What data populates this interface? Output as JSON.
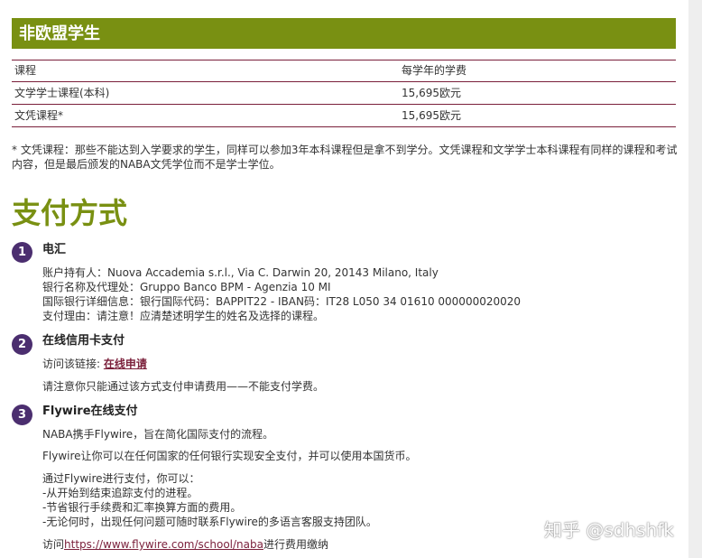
{
  "header": {
    "title": "非欧盟学生"
  },
  "fee_table": {
    "columns": [
      "课程",
      "每学年的学费"
    ],
    "rows": [
      [
        "文学学士课程(本科)",
        "15,695欧元"
      ],
      [
        "文凭课程*",
        "15,695欧元"
      ]
    ]
  },
  "note": "* 文凭课程：那些不能达到入学要求的学生，同样可以参加3年本科课程但是拿不到学分。文凭课程和文学学士本科课程有同样的课程和考试内容，但是最后颁发的NABA文凭学位而不是学士学位。",
  "payment": {
    "title": "支付方式",
    "steps": [
      {
        "number": "1",
        "title": "电汇",
        "lines": [
          "账户持有人：Nuova Accademia s.r.l., Via C. Darwin 20, 20143 Milano, Italy",
          "银行名称及代理处：Gruppo Banco BPM - Agenzia 10 MI",
          "国际银行详细信息：银行国际代码：BAPPIT22 - IBAN码：IT28 L050 34 01610 000000020020",
          "支付理由：请注意！应清楚述明学生的姓名及选择的课程。"
        ]
      },
      {
        "number": "2",
        "title": "在线信用卡支付",
        "visit_prefix": "访问该链接: ",
        "link_label": "在线申请",
        "note": "请注意你只能通过该方式支付申请费用——不能支付学费。"
      },
      {
        "number": "3",
        "title": "Flywire在线支付",
        "intro": "NABA携手Flywire，旨在简化国际支付的流程。",
        "desc": "Flywire让你可以在任何国家的任何银行实现安全支付，并可以使用本国货币。",
        "via_label": "通过Flywire进行支付，你可以：",
        "bullets": [
          "-从开始到结束追踪支付的进程。",
          "-节省银行手续费和汇率换算方面的费用。",
          "-无论何时，出现任何问题可随时联系Flywire的多语言客服支持团队。"
        ],
        "visit_prefix": "访问",
        "url": "https://www.flywire.com/school/naba",
        "visit_suffix": "进行费用缴纳"
      }
    ]
  },
  "watermark": "知乎 @sdhshfk",
  "colors": {
    "accent_green": "#799012",
    "rule_maroon": "#7a1f3a",
    "badge_purple": "#4b2e6f"
  }
}
